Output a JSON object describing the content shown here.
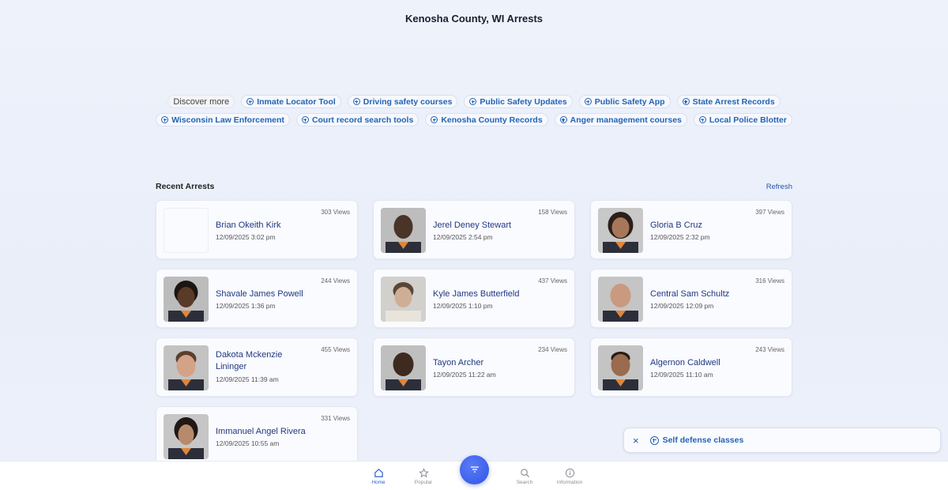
{
  "page_title": "Kenosha County, WI Arrests",
  "discover": {
    "label": "Discover more",
    "row1": [
      "Inmate Locator Tool",
      "Driving safety courses",
      "Public Safety Updates",
      "Public Safety App",
      "State Arrest Records"
    ],
    "row2": [
      "Wisconsin Law Enforcement",
      "Court record search tools",
      "Kenosha County Records",
      "Anger management courses",
      "Local Police Blotter"
    ]
  },
  "section": {
    "title": "Recent Arrests",
    "refresh": "Refresh"
  },
  "arrests": [
    {
      "name": "Brian Okeith Kirk",
      "date": "12/09/2025 3:02 pm",
      "views": "303 Views"
    },
    {
      "name": "Jerel Deney Stewart",
      "date": "12/09/2025 2:54 pm",
      "views": "158 Views"
    },
    {
      "name": "Gloria B Cruz",
      "date": "12/09/2025 2:32 pm",
      "views": "397 Views"
    },
    {
      "name": "Shavale James Powell",
      "date": "12/09/2025 1:36 pm",
      "views": "244 Views"
    },
    {
      "name": "Kyle James Butterfield",
      "date": "12/09/2025 1:10 pm",
      "views": "437 Views"
    },
    {
      "name": "Central Sam Schultz",
      "date": "12/09/2025 12:09 pm",
      "views": "316 Views"
    },
    {
      "name": "Dakota Mckenzie Lininger",
      "date": "12/09/2025 11:39 am",
      "views": "455 Views"
    },
    {
      "name": "Tayon Archer",
      "date": "12/09/2025 11:22 am",
      "views": "234 Views"
    },
    {
      "name": "Algernon Caldwell",
      "date": "12/09/2025 11:10 am",
      "views": "243 Views"
    },
    {
      "name": "Immanuel Angel Rivera",
      "date": "12/09/2025 10:55 am",
      "views": "331 Views"
    }
  ],
  "toast": {
    "close_icon": "×",
    "label": "Self defense classes"
  },
  "nav": {
    "home": "Home",
    "popular": "Popular",
    "search": "Search",
    "information": "Information"
  },
  "colors": {
    "accent": "#2464b4",
    "name_link": "#203880",
    "fab": "#3a5ee8"
  }
}
